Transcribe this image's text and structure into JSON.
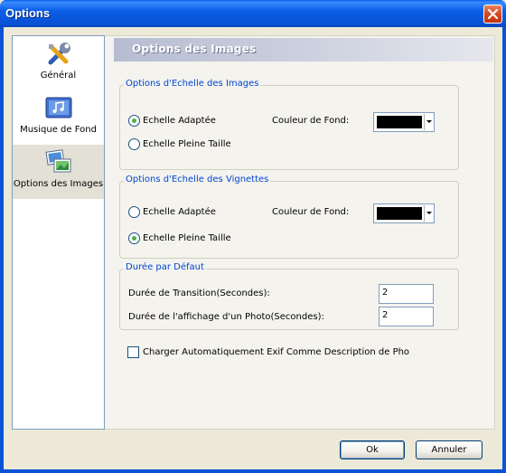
{
  "window": {
    "title": "Options"
  },
  "nav": {
    "items": [
      {
        "label": "Général",
        "icon": "tools-icon"
      },
      {
        "label": "Musique de Fond",
        "icon": "music-icon"
      },
      {
        "label": "Options des Images",
        "icon": "images-icon",
        "selected": true
      }
    ]
  },
  "panel": {
    "header": "Options des Images"
  },
  "image_scale": {
    "title": "Options d'Echelle des Images",
    "option_fit": "Echelle Adaptée",
    "option_full": "Echelle Pleine Taille",
    "selected": "fit",
    "bg_color_label": "Couleur de Fond:",
    "bg_color": "#000000"
  },
  "thumb_scale": {
    "title": "Options d'Echelle des Vignettes",
    "option_fit": "Echelle Adaptée",
    "option_full": "Echelle Pleine Taille",
    "selected": "full",
    "bg_color_label": "Couleur de Fond:",
    "bg_color": "#000000"
  },
  "duration": {
    "title": "Durée par Défaut",
    "transition_label": "Durée de Transition(Secondes):",
    "transition_value": "2",
    "display_label": "Durée de l'affichage d'un Photo(Secondes):",
    "display_value": "2"
  },
  "exif": {
    "label": "Charger Automatiquement  Exif Comme Description de Pho",
    "checked": false
  },
  "buttons": {
    "ok": "Ok",
    "cancel": "Annuler"
  },
  "colors": {
    "accent": "#0046D5",
    "titlebar": "#0A5EEA",
    "radio_dot": "#4CB046"
  }
}
